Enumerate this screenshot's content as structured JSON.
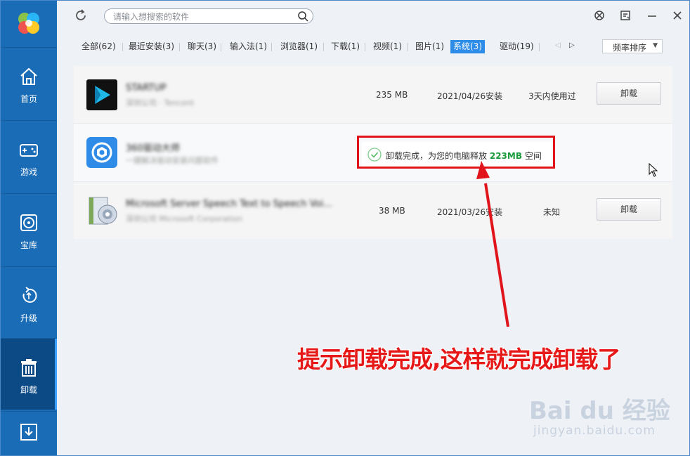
{
  "sidebar": {
    "items": [
      {
        "label": "首页",
        "icon": "home-icon"
      },
      {
        "label": "游戏",
        "icon": "gamepad-icon"
      },
      {
        "label": "宝库",
        "icon": "disc-icon"
      },
      {
        "label": "升级",
        "icon": "upgrade-icon"
      },
      {
        "label": "卸载",
        "icon": "trash-icon",
        "active": true
      }
    ],
    "bottom_icon": "download-icon"
  },
  "search": {
    "placeholder": "请输入想搜索的软件"
  },
  "tabs": [
    "全部(62)",
    "最近安装(3)",
    "聊天(3)",
    "输入法(1)",
    "浏览器(1)",
    "下载(1)",
    "视频(1)",
    "图片(1)",
    "系统(3)",
    "驱动(19)"
  ],
  "active_tab": "系统(3)",
  "sort": {
    "label": "频率排序"
  },
  "apps": [
    {
      "name": "STARTUP",
      "desc": "深圳公司 · Tencent",
      "size": "235 MB",
      "date": "2021/04/26安装",
      "usage": "3天内使用过",
      "button": "卸载"
    },
    {
      "name": "360驱动大师",
      "desc": "一键解决驱动安装问题软件",
      "done_text": "卸载完成，为您的电脑释放",
      "done_amount": "223MB",
      "done_suffix": "空间"
    },
    {
      "name": "Microsoft Server Speech Text to Speech Voi...",
      "desc": "深圳公司 Microsoft Corporation",
      "size": "38 MB",
      "date": "2021/03/26安装",
      "usage": "未知",
      "button": "卸载"
    }
  ],
  "annotation": "提示卸载完成,这样就完成卸载了",
  "watermark": {
    "line1": "Bai du 经验",
    "line2": "jingyan.baidu.com"
  },
  "colors": {
    "sidebar": "#1a6cb6",
    "accent": "#2c8ce8",
    "highlight": "#e0141a",
    "success": "#1a9a3a"
  }
}
